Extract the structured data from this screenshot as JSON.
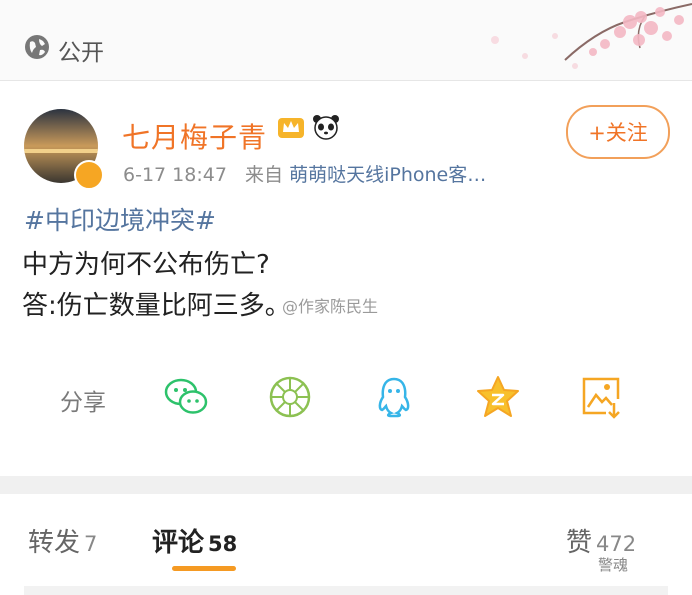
{
  "visibility": {
    "label": "公开",
    "icon": "globe-icon"
  },
  "post": {
    "username": "七月梅子青",
    "badges": [
      "crown-icon",
      "panda-icon"
    ],
    "time": "6-17 18:47",
    "source_prefix": "来自",
    "source": "萌萌哒天线iPhone客…",
    "follow_label": "+关注",
    "hashtag": "#中印边境冲突#",
    "lines": [
      "中方为何不公布伤亡?",
      "答:伤亡数量比阿三多。"
    ],
    "watermark": "@作家陈民生"
  },
  "share": {
    "label": "分享",
    "targets": [
      "wechat-icon",
      "moments-icon",
      "qq-icon",
      "qzone-icon",
      "save-image-icon"
    ]
  },
  "tabs": {
    "repost_label": "转发",
    "repost_count": "7",
    "comments_label": "评论",
    "comments_count": "58",
    "likes_label": "赞",
    "likes_count": "472"
  },
  "footer_watermark": "警魂",
  "colors": {
    "accent": "#f07427",
    "link": "#55759f",
    "underline": "#f59a23"
  }
}
